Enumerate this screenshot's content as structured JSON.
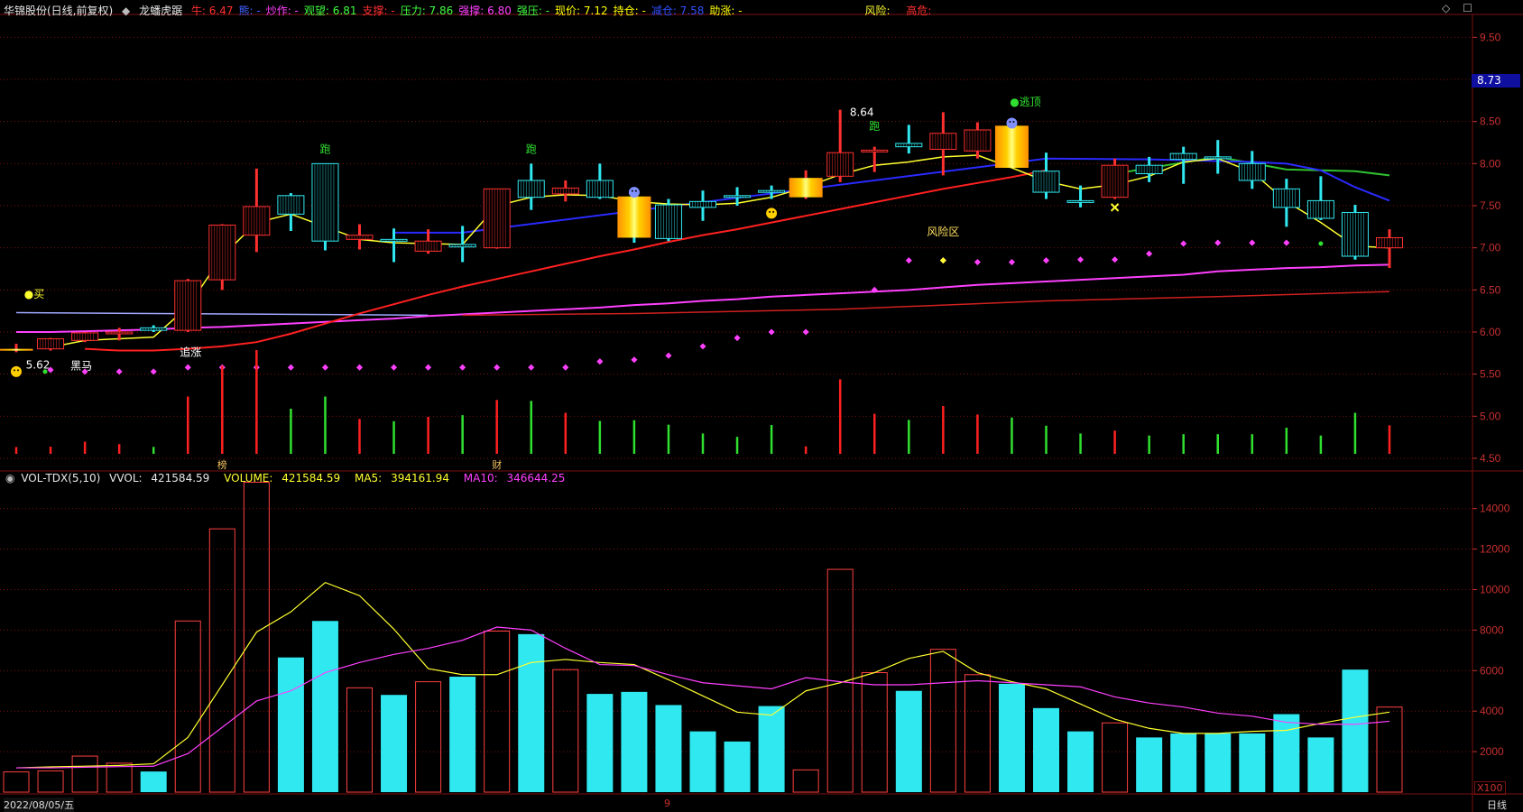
{
  "header": {
    "stock": "华锦股份(日线,前复权)",
    "indicator": "龙蟠虎踞",
    "fields": [
      {
        "label": "牛:",
        "value": "6.47",
        "color": "#ff3030"
      },
      {
        "label": "熊:",
        "value": "",
        "color": "#4060ff"
      },
      {
        "label": "炒作:",
        "value": "",
        "color": "#ff40ff"
      },
      {
        "label": "观望:",
        "value": "6.81",
        "color": "#40ff40"
      },
      {
        "label": "支撑:",
        "value": "",
        "color": "#ff3030"
      },
      {
        "label": "压力:",
        "value": "7.86",
        "color": "#40ff40"
      },
      {
        "label": "强撑:",
        "value": "6.80",
        "color": "#ff40ff"
      },
      {
        "label": "强压:",
        "value": "",
        "color": "#40ff40"
      },
      {
        "label": "现价:",
        "value": "7.12",
        "color": "#ffff00"
      },
      {
        "label": "持仓:",
        "value": "",
        "color": "#ffff00"
      },
      {
        "label": "减仓:",
        "value": "7.58",
        "color": "#3050ff"
      },
      {
        "label": "助涨:",
        "value": "",
        "color": "#ffff00"
      }
    ],
    "risk_label": "风险:",
    "risk_value": "",
    "high_risk_label": "高危:",
    "high_risk_value": ""
  },
  "vol_header": {
    "name": "VOL-TDX(5,10)",
    "vvol_label": "VVOL:",
    "vvol": "421584.59",
    "volume_label": "VOLUME:",
    "volume": "421584.59",
    "ma5_label": "MA5:",
    "ma5": "394161.94",
    "ma10_label": "MA10:",
    "ma10": "346644.25"
  },
  "price_badge": "8.73",
  "bottom": {
    "date": "2022/08/05/五",
    "period": "日线",
    "x100": "X100",
    "month_mark": "9"
  },
  "colors": {
    "up": "#ff3030",
    "down": "#30e8f0",
    "grid": "#7a1010",
    "axis_text": "#c83030",
    "yellow": "#ffff30",
    "magenta": "#ff40ff",
    "red": "#ff2020",
    "blue": "#2a2aff",
    "green": "#30c030",
    "lavender": "#a0a8ff"
  },
  "chart_data": [
    {
      "type": "candlestick",
      "title": "龙蟠虎踞",
      "ylim": [
        4.35,
        9.75
      ],
      "y_ticks": [
        4.5,
        5.0,
        5.5,
        6.0,
        6.5,
        7.0,
        7.5,
        8.0,
        8.5,
        9.0,
        9.5
      ],
      "candles": [
        {
          "o": 5.8,
          "h": 5.86,
          "l": 5.76,
          "c": 5.78,
          "v": 1000,
          "mark": "glow"
        },
        {
          "o": 5.8,
          "h": 5.93,
          "l": 5.78,
          "c": 5.92,
          "v": 1050
        },
        {
          "o": 5.9,
          "h": 6.0,
          "l": 5.88,
          "c": 5.99,
          "v": 1780
        },
        {
          "o": 5.98,
          "h": 6.05,
          "l": 5.9,
          "c": 6.0,
          "v": 1430
        },
        {
          "o": 6.02,
          "h": 6.08,
          "l": 6.0,
          "c": 6.05,
          "v": 1020,
          "down": true
        },
        {
          "o": 6.02,
          "h": 6.63,
          "l": 6.0,
          "c": 6.61,
          "v": 8450
        },
        {
          "o": 6.62,
          "h": 7.28,
          "l": 6.5,
          "c": 7.27,
          "v": 13000
        },
        {
          "o": 7.15,
          "h": 7.94,
          "l": 6.95,
          "c": 7.49,
          "v": 15300
        },
        {
          "o": 7.4,
          "h": 7.65,
          "l": 7.2,
          "c": 7.62,
          "v": 6650,
          "down": true
        },
        {
          "o": 7.08,
          "h": 8.0,
          "l": 6.97,
          "c": 8.0,
          "v": 8450,
          "down": true
        },
        {
          "o": 7.1,
          "h": 7.28,
          "l": 6.98,
          "c": 7.15,
          "v": 5150
        },
        {
          "o": 7.1,
          "h": 7.23,
          "l": 6.83,
          "c": 7.09,
          "v": 4800,
          "down": true
        },
        {
          "o": 6.96,
          "h": 7.22,
          "l": 6.93,
          "c": 7.08,
          "v": 5450
        },
        {
          "o": 7.01,
          "h": 7.26,
          "l": 6.83,
          "c": 7.04,
          "v": 5700,
          "down": true
        },
        {
          "o": 7.0,
          "h": 7.7,
          "l": 6.99,
          "c": 7.7,
          "v": 7950
        },
        {
          "o": 7.6,
          "h": 8.0,
          "l": 7.45,
          "c": 7.8,
          "v": 7800,
          "down": true
        },
        {
          "o": 7.64,
          "h": 7.8,
          "l": 7.55,
          "c": 7.71,
          "v": 6050
        },
        {
          "o": 7.6,
          "h": 8.0,
          "l": 7.58,
          "c": 7.8,
          "v": 4850,
          "down": true
        },
        {
          "o": 7.61,
          "h": 7.63,
          "l": 7.06,
          "c": 7.12,
          "v": 4950,
          "down": true,
          "mark": "glow"
        },
        {
          "o": 7.51,
          "h": 7.58,
          "l": 7.08,
          "c": 7.11,
          "v": 4300,
          "down": true
        },
        {
          "o": 7.55,
          "h": 7.68,
          "l": 7.32,
          "c": 7.48,
          "v": 3000,
          "down": true
        },
        {
          "o": 7.62,
          "h": 7.72,
          "l": 7.5,
          "c": 7.6,
          "v": 2500,
          "down": true
        },
        {
          "o": 7.66,
          "h": 7.74,
          "l": 7.58,
          "c": 7.68,
          "v": 4250,
          "down": true
        },
        {
          "o": 7.6,
          "h": 7.92,
          "l": 7.58,
          "c": 7.83,
          "v": 1100,
          "mark": "glow"
        },
        {
          "o": 7.85,
          "h": 8.64,
          "l": 7.78,
          "c": 8.13,
          "v": 11000
        },
        {
          "o": 8.15,
          "h": 8.2,
          "l": 7.9,
          "c": 8.16,
          "v": 5900
        },
        {
          "o": 8.2,
          "h": 8.46,
          "l": 8.12,
          "c": 8.24,
          "v": 5000,
          "down": true
        },
        {
          "o": 8.17,
          "h": 8.61,
          "l": 7.86,
          "c": 8.36,
          "v": 7050
        },
        {
          "o": 8.15,
          "h": 8.49,
          "l": 8.06,
          "c": 8.4,
          "v": 5800
        },
        {
          "o": 8.45,
          "h": 8.48,
          "l": 7.95,
          "c": 7.95,
          "v": 5350,
          "down": true,
          "mark": "glow"
        },
        {
          "o": 7.91,
          "h": 8.13,
          "l": 7.58,
          "c": 7.66,
          "v": 4150,
          "down": true
        },
        {
          "o": 7.56,
          "h": 7.74,
          "l": 7.48,
          "c": 7.54,
          "v": 3000,
          "down": true
        },
        {
          "o": 7.6,
          "h": 8.06,
          "l": 7.58,
          "c": 7.98,
          "v": 3420
        },
        {
          "o": 7.98,
          "h": 8.08,
          "l": 7.78,
          "c": 7.88,
          "v": 2700,
          "down": true
        },
        {
          "o": 8.12,
          "h": 8.2,
          "l": 7.76,
          "c": 8.05,
          "v": 2900,
          "down": true
        },
        {
          "o": 8.07,
          "h": 8.28,
          "l": 7.88,
          "c": 8.08,
          "v": 2900,
          "down": true
        },
        {
          "o": 8.0,
          "h": 8.15,
          "l": 7.7,
          "c": 7.8,
          "v": 2900,
          "down": true
        },
        {
          "o": 7.7,
          "h": 7.82,
          "l": 7.25,
          "c": 7.48,
          "v": 3850,
          "down": true
        },
        {
          "o": 7.56,
          "h": 7.85,
          "l": 7.33,
          "c": 7.35,
          "v": 2700,
          "down": true
        },
        {
          "o": 7.42,
          "h": 7.51,
          "l": 6.86,
          "c": 6.9,
          "v": 6050,
          "down": true
        },
        {
          "o": 7.0,
          "h": 7.22,
          "l": 6.76,
          "c": 7.12,
          "v": 4200
        }
      ],
      "ma_yellow": [
        null,
        5.82,
        5.9,
        5.92,
        5.94,
        6.3,
        6.9,
        7.3,
        7.4,
        7.25,
        7.1,
        7.06,
        7.05,
        7.04,
        7.5,
        7.6,
        7.63,
        7.62,
        7.55,
        7.52,
        7.51,
        7.53,
        7.6,
        7.72,
        7.87,
        7.98,
        8.02,
        8.08,
        8.1,
        7.95,
        7.79,
        7.7,
        7.75,
        7.85,
        8.02,
        8.06,
        7.9,
        7.55,
        7.3,
        7.02,
        7.0
      ],
      "ma_red_curve": [
        null,
        null,
        5.8,
        5.78,
        5.78,
        5.8,
        5.83,
        5.88,
        5.98,
        6.1,
        6.22,
        6.33,
        6.44,
        6.54,
        6.63,
        6.72,
        6.81,
        6.9,
        6.98,
        7.07,
        7.15,
        7.22,
        7.3,
        7.38,
        7.46,
        7.54,
        7.62,
        7.7,
        7.77,
        7.84,
        7.92
      ],
      "ma_magenta": [
        6.0,
        6.0,
        6.01,
        6.02,
        6.03,
        6.05,
        6.06,
        6.08,
        6.1,
        6.12,
        6.14,
        6.16,
        6.19,
        6.21,
        6.23,
        6.25,
        6.27,
        6.29,
        6.32,
        6.34,
        6.37,
        6.39,
        6.42,
        6.44,
        6.46,
        6.48,
        6.5,
        6.53,
        6.56,
        6.58,
        6.6,
        6.62,
        6.64,
        6.66,
        6.68,
        6.72,
        6.74,
        6.76,
        6.77,
        6.79,
        6.8
      ],
      "ma_lavender": [
        [
          0,
          6.23
        ],
        [
          12,
          6.2
        ]
      ],
      "ma_dark_red": [
        [
          13,
          6.2
        ],
        [
          18,
          6.22
        ],
        [
          24,
          6.27
        ],
        [
          30,
          6.37
        ],
        [
          35,
          6.42
        ],
        [
          40,
          6.48
        ]
      ],
      "ma_blue": [
        [
          11,
          7.18
        ],
        [
          13,
          7.18
        ],
        [
          30,
          8.06
        ],
        [
          33,
          8.05
        ],
        [
          36,
          8.02
        ],
        [
          37,
          8.0
        ],
        [
          38,
          7.92
        ],
        [
          39,
          7.72
        ],
        [
          40,
          7.56
        ]
      ],
      "ma_green": [
        [
          32,
          7.88
        ],
        [
          35,
          8.08
        ],
        [
          37,
          7.93
        ],
        [
          38,
          7.92
        ],
        [
          39,
          7.91
        ],
        [
          40,
          7.86
        ]
      ],
      "dots": [
        5.56,
        5.55,
        5.53,
        5.53,
        5.53,
        5.58,
        5.58,
        5.58,
        5.58,
        5.58,
        5.58,
        5.58,
        5.58,
        5.58,
        5.58,
        5.58,
        5.58,
        5.65,
        5.67,
        5.72,
        5.83,
        5.93,
        6.0,
        6.0,
        null,
        6.5,
        6.85,
        6.85,
        6.83,
        6.83,
        6.85,
        6.86,
        6.86,
        6.93,
        7.05,
        7.06,
        7.06,
        7.06,
        null,
        null,
        null
      ],
      "volume_ylim": [
        0,
        15500
      ],
      "volume_ticks": [
        2000,
        4000,
        6000,
        8000,
        10000,
        12000,
        14000
      ],
      "vol_ma5": [
        1200,
        1250,
        1280,
        1320,
        1400,
        2700,
        5300,
        7900,
        8900,
        10350,
        9700,
        8050,
        6100,
        5800,
        5800,
        6400,
        6550,
        6400,
        6300,
        5550,
        4750,
        3950,
        3800,
        5000,
        5400,
        5900,
        6600,
        6950,
        5900,
        5450,
        5100,
        4350,
        3600,
        3150,
        2900,
        2900,
        3000,
        3050,
        3400,
        3700,
        3950
      ],
      "vol_ma10": [
        1200,
        1200,
        1230,
        1260,
        1280,
        1900,
        3200,
        4500,
        5000,
        5900,
        6400,
        6800,
        7100,
        7500,
        8150,
        8000,
        7100,
        6300,
        6250,
        5800,
        5400,
        5250,
        5100,
        5650,
        5450,
        5300,
        5300,
        5400,
        5500,
        5400,
        5300,
        5200,
        4700,
        4400,
        4200,
        3900,
        3750,
        3450,
        3350,
        3350,
        3500
      ],
      "labels": [
        {
          "i": 9,
          "price": 8.0,
          "text": "跑",
          "color": "#30e030",
          "dy": -16
        },
        {
          "i": 15,
          "price": 8.0,
          "text": "跑",
          "color": "#30e030",
          "dy": -16
        },
        {
          "i": 24,
          "price": 8.64,
          "text": "8.64",
          "color": "#ffffff",
          "dx": 24,
          "dy": 3
        },
        {
          "i": 25,
          "price": 8.4,
          "text": "跑",
          "color": "#30e030",
          "dy": -4
        },
        {
          "i": 29,
          "price": 8.73,
          "text": "●逃顶",
          "color": "#30e030",
          "dx": 15,
          "dy": 0
        },
        {
          "i": 27,
          "price": 7.19,
          "text": "风险区",
          "color": "#ffe060",
          "dx": 0,
          "dy": 0
        },
        {
          "i": 1,
          "price": 6.45,
          "text": "●买",
          "color": "#ffff30",
          "dx": -18,
          "dy": 0
        },
        {
          "i": 0,
          "price": 5.62,
          "text": "5.62",
          "color": "#ffffff",
          "dx": 24,
          "dy": 1
        },
        {
          "i": 2,
          "price": 5.6,
          "text": "黑马",
          "color": "#ffffff",
          "dx": -4,
          "dy": 0
        },
        {
          "i": 5,
          "price": 5.76,
          "text": "追涨",
          "color": "#ffffff",
          "dx": 3,
          "dy": 0
        }
      ]
    }
  ]
}
